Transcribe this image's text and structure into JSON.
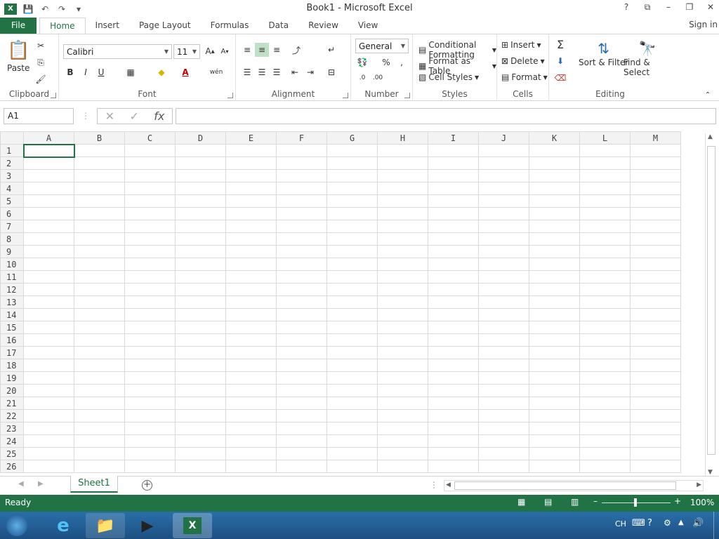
{
  "window": {
    "title": "Book1 - Microsoft Excel"
  },
  "quick_access": {
    "icons": [
      "excel-logo",
      "save-icon",
      "undo-icon",
      "redo-icon",
      "customize-icon"
    ]
  },
  "window_controls": {
    "help": "?",
    "restore_ribbon": "⧉",
    "minimize": "–",
    "maximize": "❐",
    "close": "✕"
  },
  "tabs": [
    {
      "label": "File"
    },
    {
      "label": "Home"
    },
    {
      "label": "Insert"
    },
    {
      "label": "Page Layout"
    },
    {
      "label": "Formulas"
    },
    {
      "label": "Data"
    },
    {
      "label": "Review"
    },
    {
      "label": "View"
    }
  ],
  "signin": "Sign in",
  "ribbon": {
    "clipboard": {
      "label": "Clipboard",
      "paste": "Paste"
    },
    "font": {
      "label": "Font",
      "name": "Calibri",
      "size": "11",
      "bold": "B",
      "italic": "I",
      "underline": "U"
    },
    "alignment": {
      "label": "Alignment"
    },
    "number": {
      "label": "Number",
      "format": "General"
    },
    "styles": {
      "label": "Styles",
      "conditional": "Conditional Formatting",
      "table": "Format as Table",
      "cell_styles": "Cell Styles"
    },
    "cells": {
      "label": "Cells",
      "insert": "Insert",
      "delete": "Delete",
      "format": "Format"
    },
    "editing": {
      "label": "Editing",
      "sort": "Sort & Filter",
      "find": "Find & Select"
    }
  },
  "formula_bar": {
    "name_box": "A1",
    "value": ""
  },
  "columns": [
    "A",
    "B",
    "C",
    "D",
    "E",
    "F",
    "G",
    "H",
    "I",
    "J",
    "K",
    "L",
    "M"
  ],
  "rows": [
    "1",
    "2",
    "3",
    "4",
    "5",
    "6",
    "7",
    "8",
    "9",
    "10",
    "11",
    "12",
    "13",
    "14",
    "15",
    "16",
    "17",
    "18",
    "19",
    "20",
    "21",
    "22",
    "23",
    "24",
    "25",
    "26"
  ],
  "selected_cell": "A1",
  "sheets": [
    {
      "name": "Sheet1"
    }
  ],
  "status": {
    "ready": "Ready",
    "zoom": "100%",
    "zoom_level": 1.0
  },
  "taskbar": {
    "ime": "CH"
  }
}
